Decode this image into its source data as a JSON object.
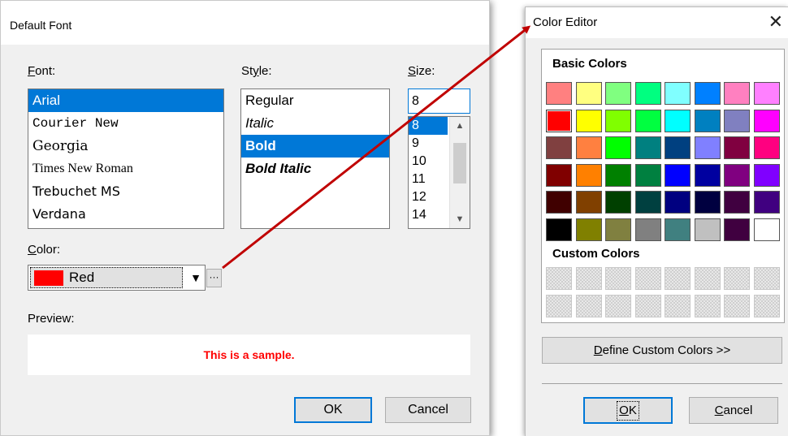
{
  "font_dialog": {
    "title": "Default Font",
    "font_label_first": "F",
    "font_label_rest": "ont:",
    "style_label_first": "St",
    "style_label_u": "y",
    "style_label_rest": "le:",
    "size_label_first": "S",
    "size_label_rest": "ize:",
    "fonts": [
      "Arial",
      "Courier New",
      "Georgia",
      "Times New Roman",
      "Trebuchet MS",
      "Verdana"
    ],
    "selected_font": "Arial",
    "styles": [
      "Regular",
      "Italic",
      "Bold",
      "Bold Italic"
    ],
    "selected_style": "Bold",
    "size_value": "8",
    "sizes": [
      "8",
      "9",
      "10",
      "11",
      "12",
      "14"
    ],
    "selected_size": "8",
    "color_label_first": "C",
    "color_label_rest": "olor:",
    "color_value": "Red",
    "color_value_hex": "#ff0000",
    "ellipsis_label": "···",
    "preview_label": "Preview:",
    "preview_text": "This is a sample.",
    "ok_label": "OK",
    "cancel_label": "Cancel"
  },
  "color_editor": {
    "title": "Color Editor",
    "basic_colors_label": "Basic Colors",
    "custom_colors_label": "Custom Colors",
    "basic_colors": [
      [
        "#ff8080",
        "#ffff80",
        "#80ff80",
        "#00ff80",
        "#80ffff",
        "#0080ff",
        "#ff80c0",
        "#ff80ff"
      ],
      [
        "#ff0000",
        "#ffff00",
        "#80ff00",
        "#00ff40",
        "#00ffff",
        "#0080c0",
        "#8080c0",
        "#ff00ff"
      ],
      [
        "#804040",
        "#ff8040",
        "#00ff00",
        "#008080",
        "#004080",
        "#8080ff",
        "#800040",
        "#ff0080"
      ],
      [
        "#800000",
        "#ff8000",
        "#008000",
        "#008040",
        "#0000ff",
        "#0000a0",
        "#800080",
        "#8000ff"
      ],
      [
        "#400000",
        "#804000",
        "#004000",
        "#004040",
        "#000080",
        "#000040",
        "#400040",
        "#400080"
      ],
      [
        "#000000",
        "#808000",
        "#808040",
        "#808080",
        "#408080",
        "#c0c0c0",
        "#400040",
        "#ffffff"
      ]
    ],
    "selected_color_row": 1,
    "selected_color_col": 0,
    "custom_rows": 2,
    "custom_cols": 8,
    "define_custom_label_first": "D",
    "define_custom_label_rest": "efine Custom Colors >>",
    "ok_label_first": "O",
    "ok_label_rest": "K",
    "cancel_label_first": "C",
    "cancel_label_rest": "ancel",
    "close_icon": "close-icon"
  },
  "annotation": {
    "arrow_color": "#c00000"
  }
}
